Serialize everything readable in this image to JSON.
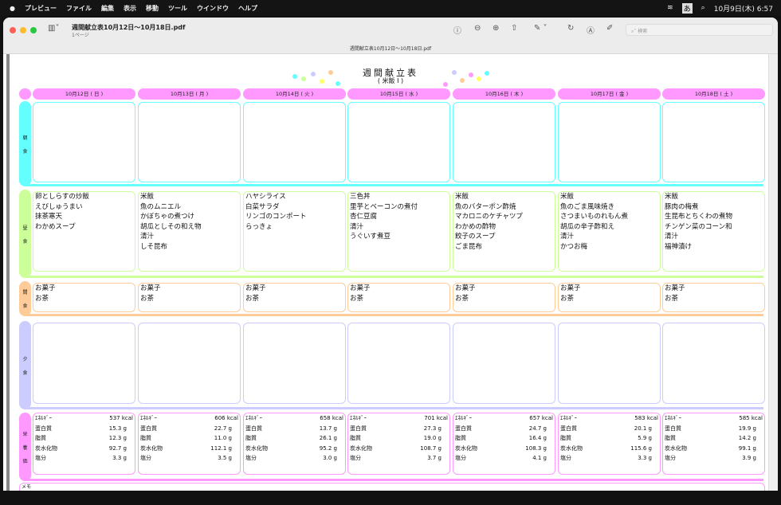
{
  "menubar": {
    "items": [
      "プレビュー",
      "ファイル",
      "編集",
      "表示",
      "移動",
      "ツール",
      "ウインドウ",
      "ヘルプ"
    ],
    "clock": "10月9日(木) 6:57",
    "input_mode": "あ"
  },
  "window": {
    "title": "週間献立表10月12日〜10月18日.pdf",
    "subtitle": "1ページ",
    "doc_name": "週間献立表10月12日〜10月18日.pdf",
    "search_placeholder": "検索"
  },
  "menu": {
    "title": "週間献立表",
    "subtitle": "( 米飯 Ⅰ )",
    "dates": [
      "10月12日 ( 日 )",
      "10月13日 ( 月 )",
      "10月14日 ( 火 )",
      "10月15日 ( 水 )",
      "10月16日 ( 木 )",
      "10月17日 ( 金 )",
      "10月18日 ( 土 )"
    ],
    "rows": [
      {
        "label": [
          "朝",
          "食"
        ],
        "color": "#66ffff",
        "cells": [
          [],
          [],
          [],
          [],
          [],
          [],
          []
        ]
      },
      {
        "label": [
          "昼",
          "食"
        ],
        "color": "#ccff99",
        "cells": [
          [
            "卵としらすの炒飯",
            "えびしゅうまい",
            "抹茶寒天",
            "わかめスープ"
          ],
          [
            "米飯",
            "魚のムニエル",
            "かぼちゃの煮つけ",
            "胡瓜としその和え物",
            "清汁",
            "しそ昆布"
          ],
          [
            "ハヤシライス",
            "白菜サラダ",
            "リンゴのコンポート",
            "らっきょ"
          ],
          [
            "三色丼",
            "里芋とベーコンの煮付",
            "杏仁豆腐",
            "清汁",
            "うぐいす煮豆"
          ],
          [
            "米飯",
            "魚のバターポン酢焼",
            "マカロニのケチャツプ",
            "わかめの酢物",
            "餃子のスープ",
            "ごま昆布"
          ],
          [
            "米飯",
            "魚のごま風味焼き",
            "さつまいものれもん煮",
            "胡瓜の辛子酢和え",
            "清汁",
            "かつお梅"
          ],
          [
            "米飯",
            "豚肉の梅煮",
            "生昆布とちくわの煮物",
            "チンゲン菜のコーン和",
            "清汁",
            "福神漬け"
          ]
        ]
      },
      {
        "label": [
          "間",
          "食"
        ],
        "color": "#ffcc99",
        "cells": [
          [
            "お菓子",
            "お茶"
          ],
          [
            "お菓子",
            "お茶"
          ],
          [
            "お菓子",
            "お茶"
          ],
          [
            "お菓子",
            "お茶"
          ],
          [
            "お菓子",
            "お茶"
          ],
          [
            "お菓子",
            "お茶"
          ],
          [
            "お菓子",
            "お茶"
          ]
        ]
      },
      {
        "label": [
          "夕",
          "食"
        ],
        "color": "#ccccff",
        "cells": [
          [],
          [],
          [],
          [],
          [],
          [],
          []
        ]
      }
    ],
    "nutrition": {
      "label": [
        "栄",
        "養",
        "価"
      ],
      "color": "#ff99ff",
      "names": [
        "ｴﾈﾙｷﾞｰ",
        "蛋白質",
        "脂質",
        "炭水化物",
        "塩分"
      ],
      "values": [
        [
          "537 kcal",
          "15.3 g",
          "12.3 g",
          "92.7 g",
          "3.3 g"
        ],
        [
          "606 kcal",
          "22.7 g",
          "11.0 g",
          "112.1 g",
          "3.5 g"
        ],
        [
          "658 kcal",
          "13.7 g",
          "26.1 g",
          "95.2 g",
          "3.0 g"
        ],
        [
          "701 kcal",
          "27.3 g",
          "19.0 g",
          "108.7 g",
          "3.7 g"
        ],
        [
          "657 kcal",
          "24.7 g",
          "16.4 g",
          "108.3 g",
          "4.1 g"
        ],
        [
          "583 kcal",
          "20.1 g",
          "5.9 g",
          "115.6 g",
          "3.3 g"
        ],
        [
          "585 kcal",
          "19.9 g",
          "14.2 g",
          "99.1 g",
          "3.9 g"
        ]
      ]
    },
    "memo_label": "メモ",
    "header_color": "#ff99ff"
  }
}
